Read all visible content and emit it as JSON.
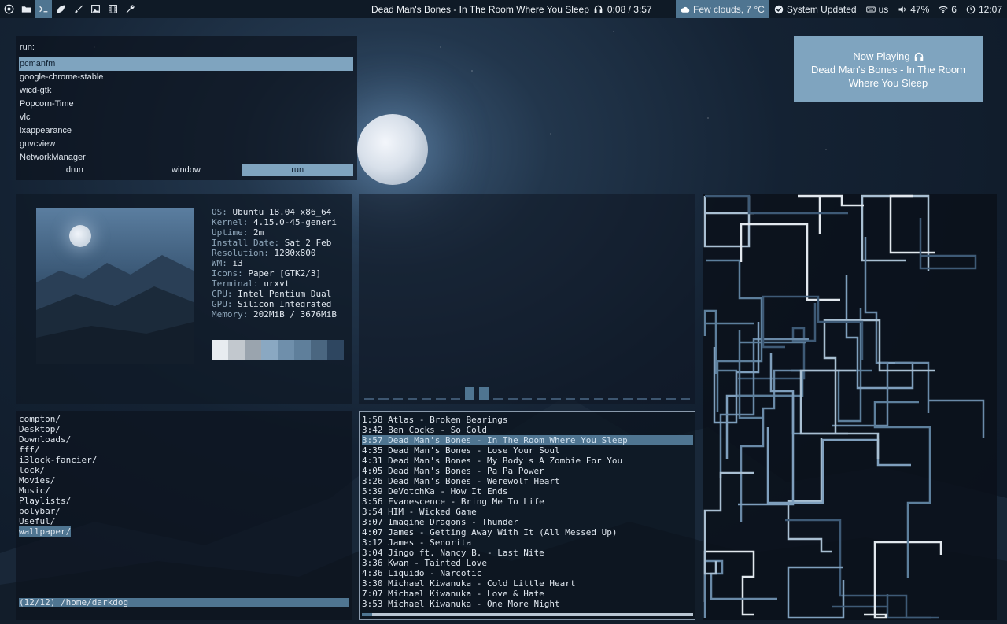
{
  "topbar": {
    "workspaces": [
      {
        "icon": "chrome-icon",
        "active": false
      },
      {
        "icon": "folder-icon",
        "active": false
      },
      {
        "icon": "terminal-icon",
        "active": true
      },
      {
        "icon": "leaf-icon",
        "active": false
      },
      {
        "icon": "brush-icon",
        "active": false
      },
      {
        "icon": "image-icon",
        "active": false
      },
      {
        "icon": "film-icon",
        "active": false
      },
      {
        "icon": "wrench-icon",
        "active": false
      }
    ],
    "now_playing": "Dead Man's Bones - In The Room Where You Sleep",
    "time_progress": "0:08 / 3:57",
    "weather": "Few clouds, 7 °C",
    "updates": "System Updated",
    "keyboard": "us",
    "volume": "47%",
    "wifi": "6",
    "clock": "12:07"
  },
  "rofi": {
    "prompt": "run:",
    "items": [
      "pcmanfm",
      "google-chrome-stable",
      "wicd-gtk",
      "Popcorn-Time",
      "vlc",
      "lxappearance",
      "guvcview",
      "NetworkManager"
    ],
    "selected_index": 0,
    "modes": [
      "drun",
      "window",
      "run"
    ],
    "active_mode": 2
  },
  "popup": {
    "heading": "Now Playing",
    "song": "Dead Man's Bones - In The Room Where You Sleep"
  },
  "neofetch": {
    "lines": [
      {
        "key": "OS",
        "value": "Ubuntu 18.04 x86_64"
      },
      {
        "key": "Kernel",
        "value": "4.15.0-45-generi"
      },
      {
        "key": "Uptime",
        "value": "2m"
      },
      {
        "key": "Install Date",
        "value": "Sat 2 Feb"
      },
      {
        "key": "Resolution",
        "value": "1280x800"
      },
      {
        "key": "WM",
        "value": "i3"
      },
      {
        "key": "Icons",
        "value": "Paper [GTK2/3]"
      },
      {
        "key": "Terminal",
        "value": "urxvt"
      },
      {
        "key": "CPU",
        "value": "Intel Pentium Dual"
      },
      {
        "key": "GPU",
        "value": "Silicon Integrated"
      },
      {
        "key": "Memory",
        "value": "202MiB / 3676MiB"
      }
    ],
    "palette": [
      "#e8ecf0",
      "#c2c8ce",
      "#9aa4ae",
      "#8aa8c2",
      "#6f8fab",
      "#5f7f9b",
      "#4a6680",
      "#2e4660"
    ]
  },
  "ranger": {
    "items": [
      "compton/",
      "Desktop/",
      "Downloads/",
      "fff/",
      "i3lock-fancier/",
      "lock/",
      "Movies/",
      "Music/",
      "Playlists/",
      "polybar/",
      "Useful/",
      "wallpaper/"
    ],
    "selected_index": 11,
    "status": "(12/12) /home/darkdog"
  },
  "cmus": {
    "tracks": [
      {
        "time": "1:58",
        "title": "Atlas - Broken Bearings"
      },
      {
        "time": "3:42",
        "title": "Ben Cocks - So Cold"
      },
      {
        "time": "3:57",
        "title": "Dead Man's Bones - In The Room Where You Sleep"
      },
      {
        "time": "4:35",
        "title": "Dead Man's Bones - Lose Your Soul"
      },
      {
        "time": "4:31",
        "title": "Dead Man's Bones - My Body's A Zombie For You"
      },
      {
        "time": "4:05",
        "title": "Dead Man's Bones - Pa Pa Power"
      },
      {
        "time": "3:26",
        "title": "Dead Man's Bones - Werewolf Heart"
      },
      {
        "time": "5:39",
        "title": "DeVotchKa - How It Ends"
      },
      {
        "time": "3:56",
        "title": "Evanescence - Bring Me To Life"
      },
      {
        "time": "3:54",
        "title": "HIM - Wicked Game"
      },
      {
        "time": "3:07",
        "title": "Imagine Dragons - Thunder"
      },
      {
        "time": "4:07",
        "title": "James - Getting Away With It (All Messed Up)"
      },
      {
        "time": "3:12",
        "title": "James - Senorita"
      },
      {
        "time": "3:04",
        "title": "Jingo ft. Nancy B. - Last Nite"
      },
      {
        "time": "3:36",
        "title": "Kwan - Tainted Love"
      },
      {
        "time": "4:36",
        "title": "Liquido - Narcotic"
      },
      {
        "time": "3:30",
        "title": "Michael Kiwanuka - Cold Little Heart"
      },
      {
        "time": "7:07",
        "title": "Michael Kiwanuka - Love & Hate"
      },
      {
        "time": "3:53",
        "title": "Michael Kiwanuka - One More Night"
      }
    ],
    "selected_index": 2,
    "progress": 0.03
  },
  "visualizer": {
    "levels": [
      0,
      0,
      0,
      0,
      0,
      0,
      0,
      1,
      1,
      0,
      0,
      0,
      0,
      0,
      0,
      0,
      0,
      0,
      0,
      0,
      0,
      0,
      0
    ]
  }
}
